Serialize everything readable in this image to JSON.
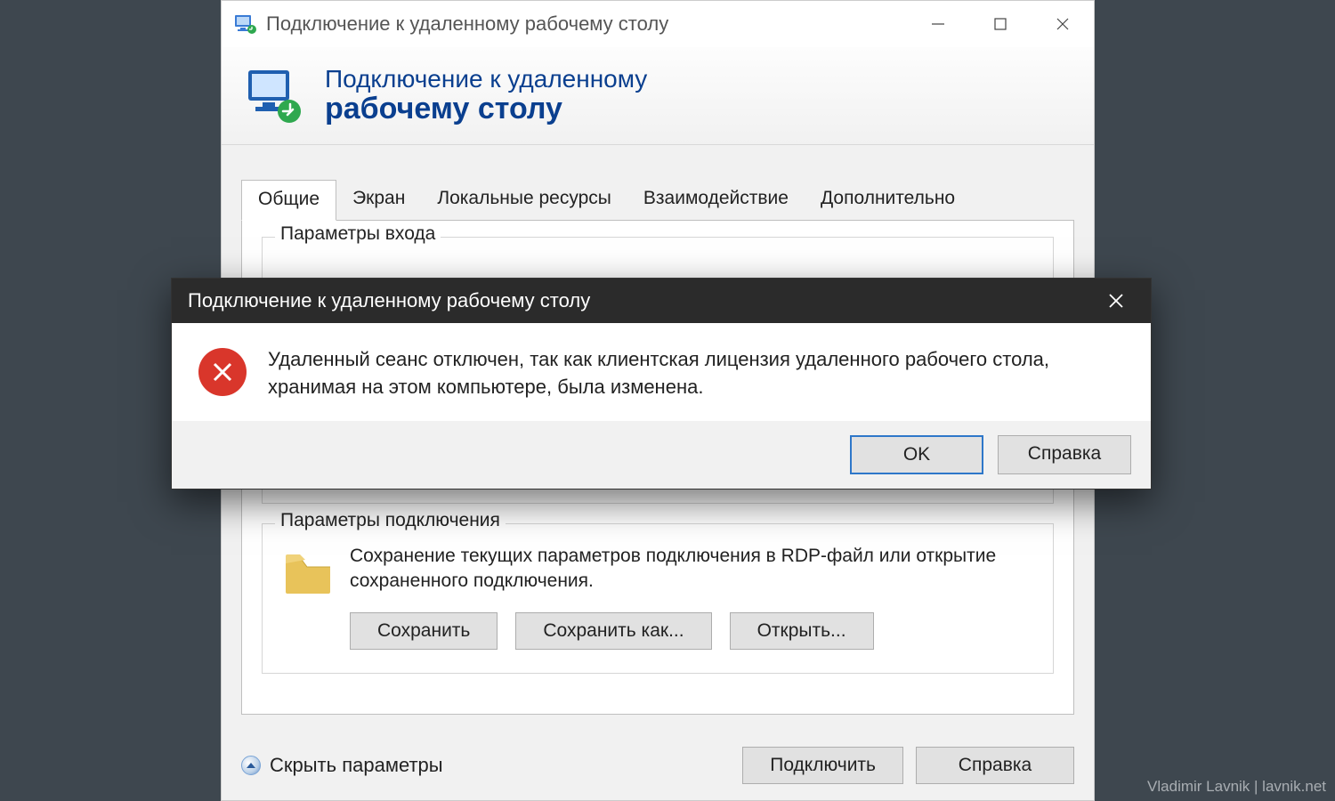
{
  "main_window": {
    "title": "Подключение к удаленному рабочему столу",
    "banner": {
      "line1": "Подключение к удаленному",
      "line2": "рабочему столу"
    },
    "tabs": [
      "Общие",
      "Экран",
      "Локальные ресурсы",
      "Взаимодействие",
      "Дополнительно"
    ],
    "active_tab_index": 0,
    "login_group": {
      "legend": "Параметры входа"
    },
    "conn_group": {
      "legend": "Параметры подключения",
      "desc": "Сохранение текущих параметров подключения в RDP-файл или открытие сохраненного подключения.",
      "save_label": "Сохранить",
      "save_as_label": "Сохранить как...",
      "open_label": "Открыть..."
    },
    "footer": {
      "hide_label": "Скрыть параметры",
      "connect_label": "Подключить",
      "help_label": "Справка"
    }
  },
  "dialog": {
    "title": "Подключение к удаленному рабочему столу",
    "message": "Удаленный сеанс отключен, так как клиентская лицензия удаленного рабочего стола, хранимая на этом компьютере, была изменена.",
    "ok_label": "OK",
    "help_label": "Справка"
  },
  "watermark": "Vladimir Lavnik | lavnik.net"
}
